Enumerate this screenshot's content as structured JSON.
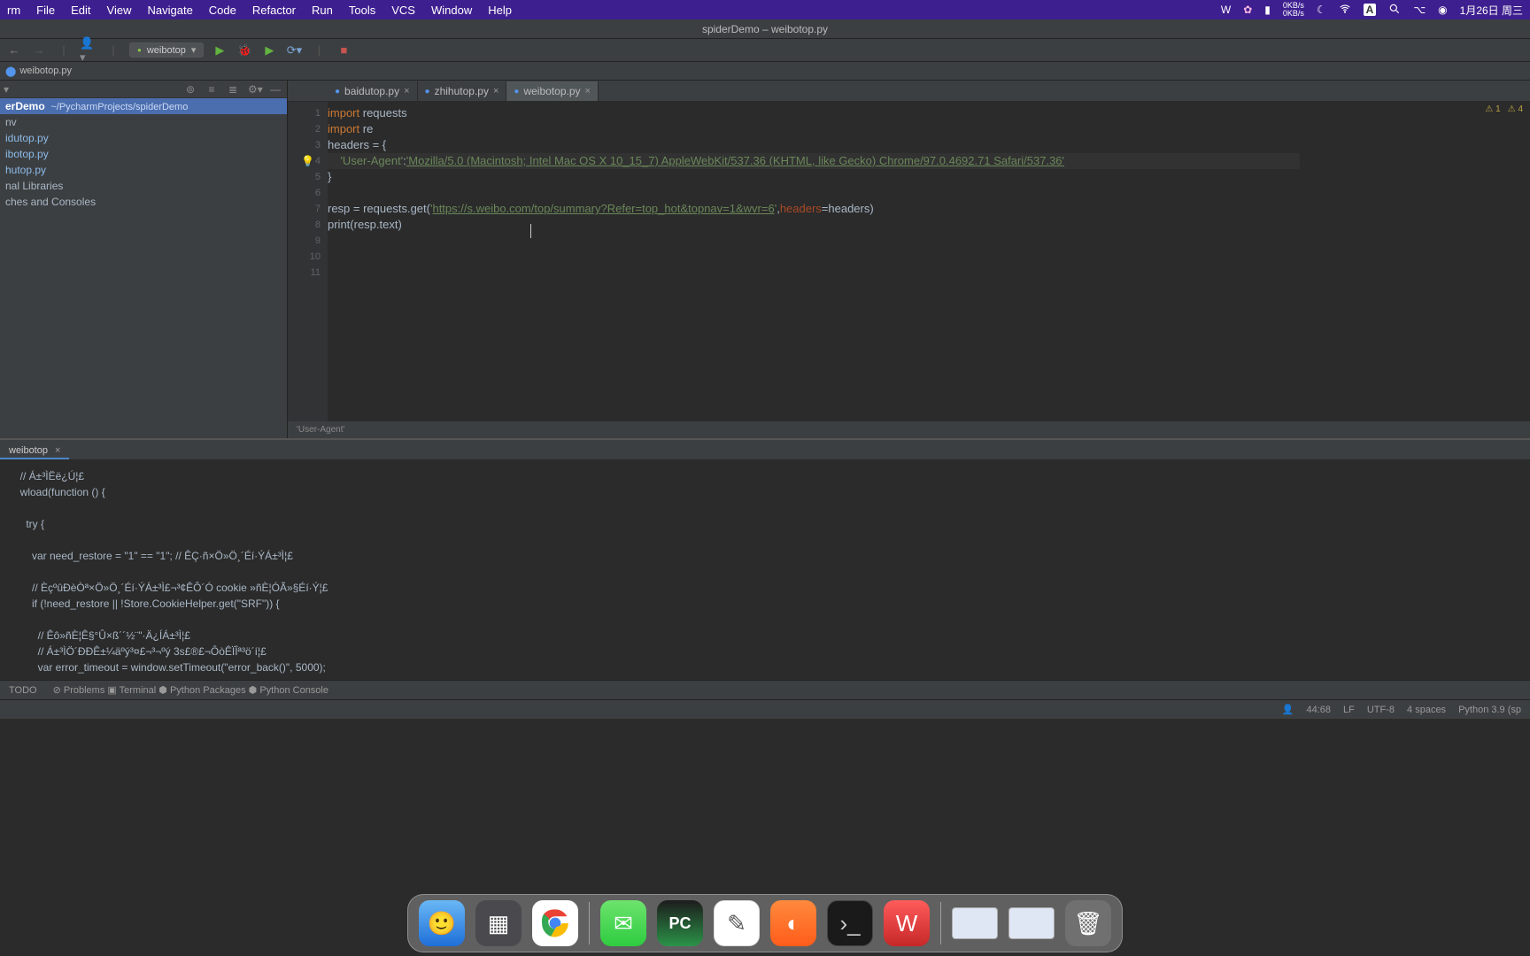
{
  "mac_menu": {
    "app": "rm",
    "items": [
      "File",
      "Edit",
      "View",
      "Navigate",
      "Code",
      "Refactor",
      "Run",
      "Tools",
      "VCS",
      "Window",
      "Help"
    ],
    "net_up": "0KB/s",
    "net_dn": "0KB/s",
    "date": "1月26日 周三"
  },
  "titlebar": "spiderDemo – weibotop.py",
  "toolbar": {
    "run_config": "weibotop"
  },
  "crumb": {
    "file": "weibotop.py"
  },
  "sidebar": {
    "project_root": "erDemo",
    "project_path": "~/PycharmProjects/spiderDemo",
    "items": [
      "nv",
      "idutop.py",
      "ibotop.py",
      "hutop.py",
      "nal Libraries",
      "ches and Consoles"
    ]
  },
  "tabs": [
    {
      "label": "baidutop.py",
      "active": false
    },
    {
      "label": "zhihutop.py",
      "active": false
    },
    {
      "label": "weibotop.py",
      "active": true
    }
  ],
  "gutter": [
    "1",
    "2",
    "3",
    "4",
    "5",
    "6",
    "7",
    "8",
    "9",
    "10",
    "11"
  ],
  "code": {
    "l1a": "import ",
    "l1b": "requests",
    "l2a": "import ",
    "l2b": "re",
    "l3": "headers = {",
    "l4a": "    'User-Agent'",
    "l4b": ":",
    "l4c": "'Mozilla/5.0 (Macintosh; Intel Mac OS X 10_15_7) AppleWebKit/537.36 (KHTML, like Gecko) Chrome/97.0.4692.71 Safari/537.36'",
    "l5": "}",
    "l7a": "resp = requests.get(",
    "l7b": "'",
    "l7c": "https://s.weibo.com/top/summary?Refer=top_hot&topnav=1&wvr=6",
    "l7d": "'",
    "l7e": ",",
    "l7f": "headers",
    "l7g": "=headers)",
    "l8": "print(resp.text)"
  },
  "inspections": {
    "w1": "1",
    "w2": "4"
  },
  "breadcrumb_bottom": "'User-Agent'",
  "run_panel": {
    "tab": "weibotop",
    "lines": [
      "  // Á±³ÌËë¿Ú¦£",
      "  wload(function () {",
      "",
      "    try {",
      "",
      "      var need_restore = \"1\" == \"1\"; // ÊÇ·ñ×Ö»Ö¸´Éí·ÝÁ±³Ì¦£",
      "",
      "      // ÈçºûÐèÒª×Ö»Ö¸´Éí·ÝÁ±³Ì£¬³¢ÊÔ´Ó cookie »ñÈ¦ÓÃ»§Éí·Ý¦£",
      "      if (!need_restore || !Store.CookieHelper.get(\"SRF\")) {",
      "",
      "        // Êô»ñÈ¦Ê§°Û×ß´´½¨\"·Ä¿ÍÁ±³Ì¦£",
      "        // Á±³ÌÖ´ÐÐÊ±¼äºý³¤£¬³¬ºý 3s£®£¬ÔòÊÏÎª³ö´í¦£",
      "        var error_timeout = window.setTimeout(\"error_back()\", 5000);"
    ]
  },
  "toolwin": {
    "items": [
      "TODO",
      "Problems",
      "Terminal",
      "Python Packages",
      "Python Console"
    ]
  },
  "status": {
    "pos": "44:68",
    "eol": "LF",
    "enc": "UTF-8",
    "indent": "4 spaces",
    "sdk": "Python 3.9 (sp"
  }
}
